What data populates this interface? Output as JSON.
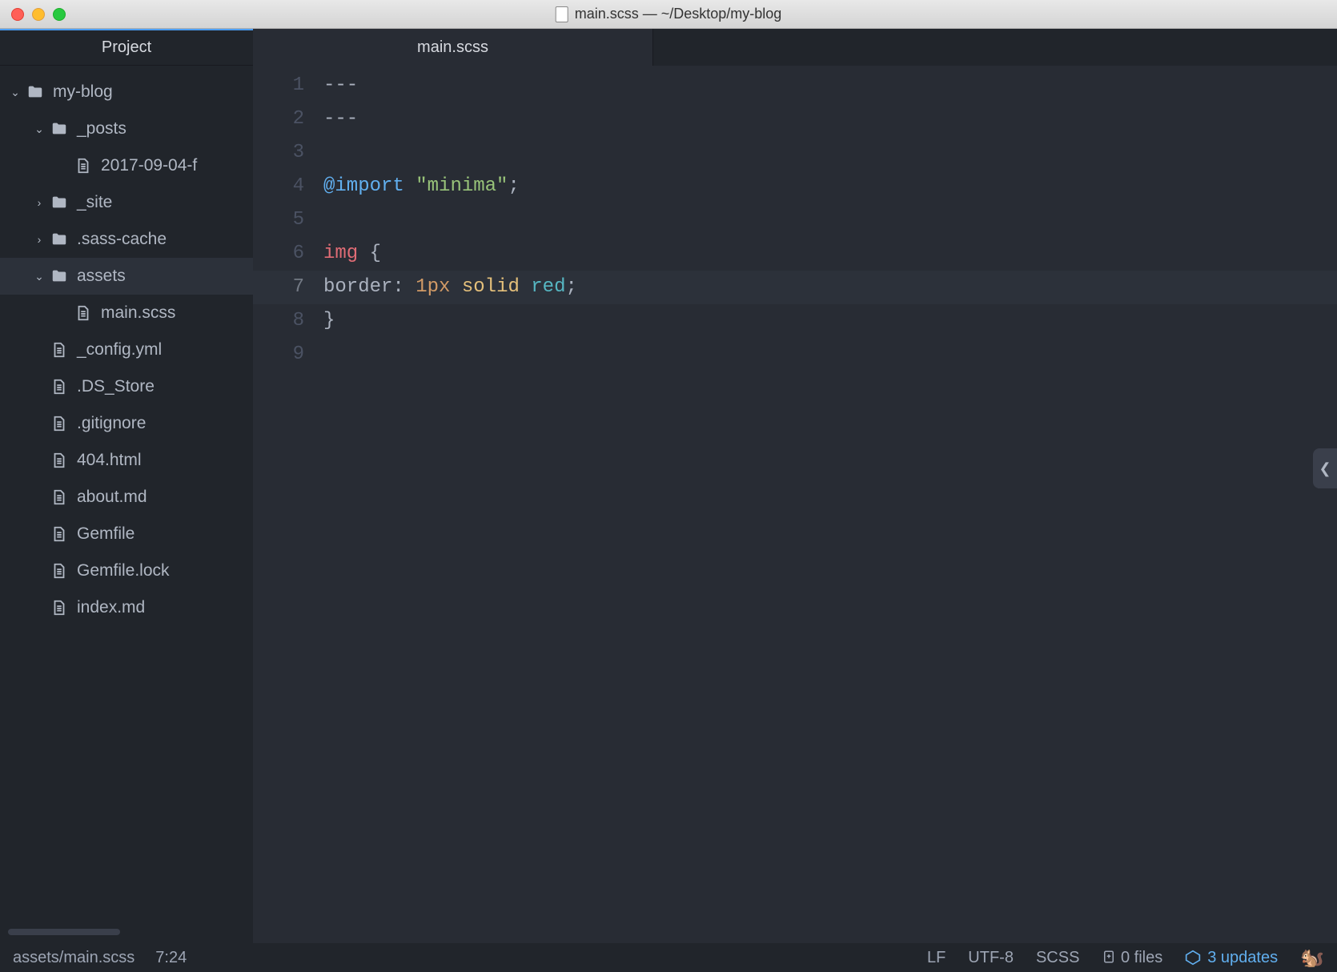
{
  "window": {
    "title": "main.scss — ~/Desktop/my-blog"
  },
  "sidebar": {
    "header": "Project",
    "items": [
      {
        "label": "my-blog",
        "kind": "folder",
        "expanded": true,
        "depth": 0
      },
      {
        "label": "_posts",
        "kind": "folder",
        "expanded": true,
        "depth": 1
      },
      {
        "label": "2017-09-04-f",
        "kind": "file",
        "depth": 2
      },
      {
        "label": "_site",
        "kind": "folder",
        "expanded": false,
        "depth": 1
      },
      {
        "label": ".sass-cache",
        "kind": "folder",
        "expanded": false,
        "depth": 1
      },
      {
        "label": "assets",
        "kind": "folder",
        "expanded": true,
        "depth": 1,
        "selected": true
      },
      {
        "label": "main.scss",
        "kind": "file",
        "depth": 2
      },
      {
        "label": "_config.yml",
        "kind": "file",
        "depth": 1
      },
      {
        "label": ".DS_Store",
        "kind": "file",
        "depth": 1
      },
      {
        "label": ".gitignore",
        "kind": "file",
        "depth": 1
      },
      {
        "label": "404.html",
        "kind": "file",
        "depth": 1
      },
      {
        "label": "about.md",
        "kind": "file",
        "depth": 1
      },
      {
        "label": "Gemfile",
        "kind": "file",
        "depth": 1
      },
      {
        "label": "Gemfile.lock",
        "kind": "file",
        "depth": 1
      },
      {
        "label": "index.md",
        "kind": "file",
        "depth": 1
      }
    ]
  },
  "tabs": [
    {
      "label": "main.scss"
    }
  ],
  "editor": {
    "current_line": 7,
    "line_numbers": [
      "1",
      "2",
      "3",
      "4",
      "5",
      "6",
      "7",
      "8",
      "9"
    ],
    "lines": {
      "l1": "---",
      "l2": "---",
      "l4_at": "@import",
      "l4_str": "\"minima\"",
      "l4_end": ";",
      "l6_tag": "img",
      "l6_brace": " {",
      "l7_indent": "  ",
      "l7_prop": "border",
      "l7_colon": ": ",
      "l7_num": "1px",
      "l7_sp1": " ",
      "l7_kw": "solid",
      "l7_sp2": " ",
      "l7_val": "red",
      "l7_end": ";",
      "l8": "}"
    }
  },
  "status": {
    "path": "assets/main.scss",
    "cursor": "7:24",
    "eol": "LF",
    "encoding": "UTF-8",
    "grammar": "SCSS",
    "git_files": "0 files",
    "updates": "3 updates"
  }
}
